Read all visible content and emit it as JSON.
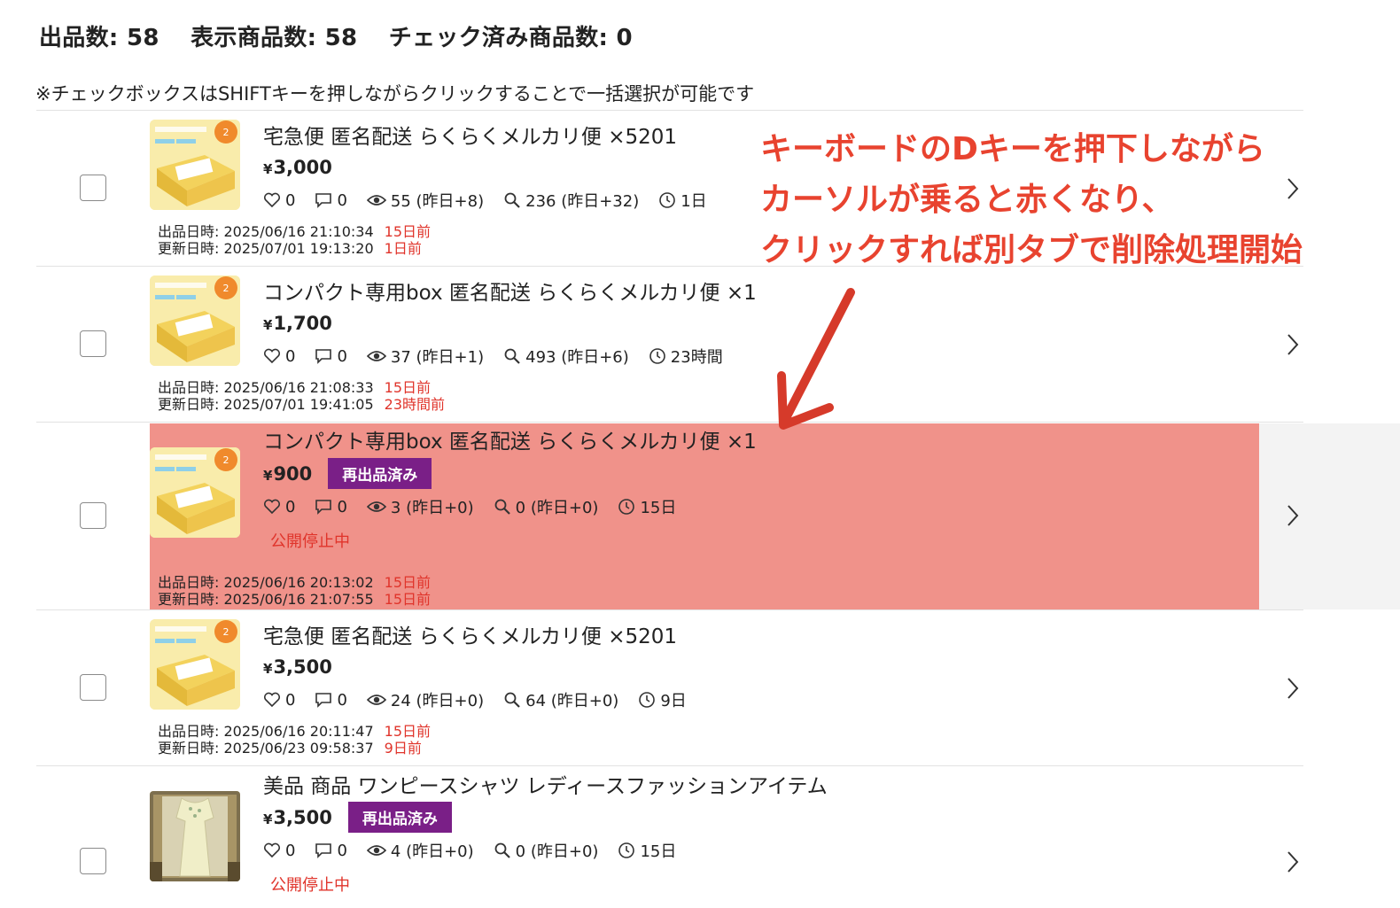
{
  "summary": {
    "listed": "出品数: 58",
    "displayed": "表示商品数: 58",
    "checked": "チェック済み商品数: 0"
  },
  "note": "※チェックボックスはSHIFTキーを押しながらクリックすることで一括選択が可能です",
  "annotation": {
    "line1": "キーボードのDキーを押下しながら",
    "line2": "カーソルが乗ると赤くなり、",
    "line3": "クリックすれば別タブで削除処理開始"
  },
  "items": [
    {
      "title": "宅急便 匿名配送 らくらくメルカリ便 ×5201",
      "yen": "¥",
      "price": "3,000",
      "badge": "",
      "likes": "0",
      "comments": "0",
      "views": "55 (昨日+8)",
      "searches": "236 (昨日+32)",
      "age": "1日",
      "status": "",
      "listed_date": "出品日時: 2025/06/16 21:10:34",
      "listed_ago": "15日前",
      "updated_date": "更新日時: 2025/07/01 19:13:20",
      "updated_ago": "1日前"
    },
    {
      "title": "コンパクト専用box 匿名配送 らくらくメルカリ便 ×1",
      "yen": "¥",
      "price": "1,700",
      "badge": "",
      "likes": "0",
      "comments": "0",
      "views": "37 (昨日+1)",
      "searches": "493 (昨日+6)",
      "age": "23時間",
      "status": "",
      "listed_date": "出品日時: 2025/06/16 21:08:33",
      "listed_ago": "15日前",
      "updated_date": "更新日時: 2025/07/01 19:41:05",
      "updated_ago": "23時間前"
    },
    {
      "title": "コンパクト専用box 匿名配送 らくらくメルカリ便 ×1",
      "yen": "¥",
      "price": "900",
      "badge": "再出品済み",
      "likes": "0",
      "comments": "0",
      "views": "3 (昨日+0)",
      "searches": "0 (昨日+0)",
      "age": "15日",
      "status": "公開停止中",
      "listed_date": "出品日時: 2025/06/16 20:13:02",
      "listed_ago": "15日前",
      "updated_date": "更新日時: 2025/06/16 21:07:55",
      "updated_ago": "15日前"
    },
    {
      "title": "宅急便 匿名配送 らくらくメルカリ便 ×5201",
      "yen": "¥",
      "price": "3,500",
      "badge": "",
      "likes": "0",
      "comments": "0",
      "views": "24 (昨日+0)",
      "searches": "64 (昨日+0)",
      "age": "9日",
      "status": "",
      "listed_date": "出品日時: 2025/06/16 20:11:47",
      "listed_ago": "15日前",
      "updated_date": "更新日時: 2025/06/23 09:58:37",
      "updated_ago": "9日前"
    },
    {
      "title": "美品 商品 ワンピースシャツ レディースファッションアイテム",
      "yen": "¥",
      "price": "3,500",
      "badge": "再出品済み",
      "likes": "0",
      "comments": "0",
      "views": "4 (昨日+0)",
      "searches": "0 (昨日+0)",
      "age": "15日",
      "status": "公開停止中",
      "listed_date": "",
      "listed_ago": "",
      "updated_date": "",
      "updated_ago": ""
    }
  ]
}
